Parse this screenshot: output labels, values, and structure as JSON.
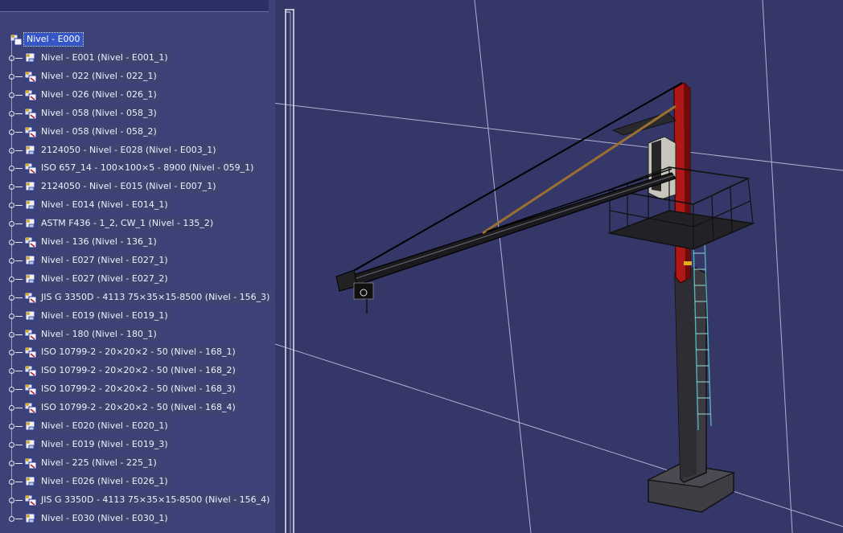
{
  "colors": {
    "viewport_bg": "#343767",
    "tree_bg": "#3c4278",
    "selection": "#3556c6",
    "grid_lines": "#d8dcf5",
    "mast_red": "#b01818"
  },
  "tree": {
    "root": {
      "label": "Nivel - E000",
      "icon": "assembly-icon",
      "selected": true
    },
    "items": [
      {
        "label": "Nivel - E001 (Nivel - E001_1)",
        "icon": "part-icon"
      },
      {
        "label": "Nivel - 022 (Nivel - 022_1)",
        "icon": "assembly-icon"
      },
      {
        "label": "Nivel - 026 (Nivel - 026_1)",
        "icon": "assembly-icon"
      },
      {
        "label": "Nivel - 058 (Nivel - 058_3)",
        "icon": "assembly-icon"
      },
      {
        "label": "Nivel - 058 (Nivel - 058_2)",
        "icon": "assembly-icon"
      },
      {
        "label": "2124050 - Nivel - E028 (Nivel - E003_1)",
        "icon": "part-icon"
      },
      {
        "label": "ISO 657_14 - 100×100×5 - 8900 (Nivel - 059_1)",
        "icon": "assembly-icon"
      },
      {
        "label": "2124050 - Nivel - E015 (Nivel - E007_1)",
        "icon": "part-icon"
      },
      {
        "label": "Nivel - E014 (Nivel - E014_1)",
        "icon": "part-icon"
      },
      {
        "label": "ASTM F436 - 1_2, CW_1 (Nivel - 135_2)",
        "icon": "part-icon"
      },
      {
        "label": "Nivel - 136 (Nivel - 136_1)",
        "icon": "assembly-icon"
      },
      {
        "label": "Nivel - E027 (Nivel - E027_1)",
        "icon": "part-icon"
      },
      {
        "label": "Nivel - E027 (Nivel - E027_2)",
        "icon": "part-icon"
      },
      {
        "label": "JIS G 3350D - 4113     75×35×15-8500 (Nivel - 156_3)",
        "icon": "assembly-icon"
      },
      {
        "label": "Nivel - E019 (Nivel - E019_1)",
        "icon": "part-icon"
      },
      {
        "label": "Nivel - 180 (Nivel - 180_1)",
        "icon": "assembly-icon"
      },
      {
        "label": "ISO 10799-2 - 20×20×2 - 50 (Nivel - 168_1)",
        "icon": "assembly-icon"
      },
      {
        "label": "ISO 10799-2 - 20×20×2 - 50 (Nivel - 168_2)",
        "icon": "assembly-icon"
      },
      {
        "label": "ISO 10799-2 - 20×20×2 - 50 (Nivel - 168_3)",
        "icon": "assembly-icon"
      },
      {
        "label": "ISO 10799-2 - 20×20×2 - 50 (Nivel - 168_4)",
        "icon": "assembly-icon"
      },
      {
        "label": "Nivel - E020 (Nivel - E020_1)",
        "icon": "part-icon"
      },
      {
        "label": "Nivel - E019 (Nivel - E019_3)",
        "icon": "part-icon"
      },
      {
        "label": "Nivel - 225 (Nivel - 225_1)",
        "icon": "assembly-icon"
      },
      {
        "label": "Nivel - E026 (Nivel - E026_1)",
        "icon": "part-icon"
      },
      {
        "label": "JIS G 3350D - 4113     75×35×15-8500 (Nivel - 156_4)",
        "icon": "assembly-icon"
      },
      {
        "label": "Nivel - E030 (Nivel - E030_1)",
        "icon": "part-icon"
      }
    ]
  },
  "viewport": {
    "model_name": "jib-crane-model",
    "compass_icon": "compass-icon"
  }
}
